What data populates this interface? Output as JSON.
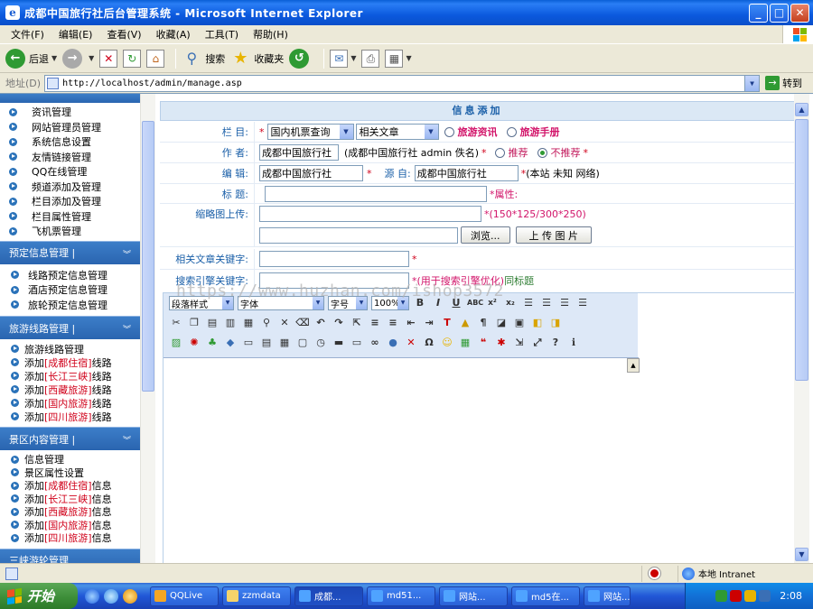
{
  "window": {
    "title": "成都中国旅行社后台管理系统 - Microsoft Internet Explorer",
    "min": "_",
    "max": "□",
    "close": "✕"
  },
  "menu": [
    "文件(F)",
    "编辑(E)",
    "查看(V)",
    "收藏(A)",
    "工具(T)",
    "帮助(H)"
  ],
  "toolbar": {
    "back": "后退",
    "search": "搜索",
    "favorites": "收藏夹"
  },
  "address": {
    "label": "地址(D)",
    "url": "http://localhost/admin/manage.asp",
    "go": "转到"
  },
  "sidebar": {
    "group1_items": [
      "资讯管理",
      "网站管理员管理",
      "系统信息设置",
      "友情链接管理",
      "QQ在线管理",
      "频道添加及管理",
      "栏目添加及管理",
      "栏目属性管理",
      "飞机票管理"
    ],
    "group2": {
      "title": "预定信息管理 |",
      "items": [
        "线路预定信息管理",
        "酒店预定信息管理",
        "旅轮预定信息管理"
      ]
    },
    "group3": {
      "title": "旅游线路管理 |",
      "first": "旅游线路管理",
      "items": [
        {
          "pre": "添加",
          "red": "[成都住宿]",
          "post": "线路"
        },
        {
          "pre": "添加",
          "red": "[长江三峡]",
          "post": "线路"
        },
        {
          "pre": "添加",
          "red": "[西藏旅游]",
          "post": "线路"
        },
        {
          "pre": "添加",
          "red": "[国内旅游]",
          "post": "线路"
        },
        {
          "pre": "添加",
          "red": "[四川旅游]",
          "post": "线路"
        }
      ]
    },
    "group4": {
      "title": "景区内容管理 |",
      "plain": [
        "信息管理",
        "景区属性设置"
      ],
      "items": [
        {
          "pre": "添加",
          "red": "[成都住宿]",
          "post": "信息"
        },
        {
          "pre": "添加",
          "red": "[长江三峡]",
          "post": "信息"
        },
        {
          "pre": "添加",
          "red": "[西藏旅游]",
          "post": "信息"
        },
        {
          "pre": "添加",
          "red": "[国内旅游]",
          "post": "信息"
        },
        {
          "pre": "添加",
          "red": "[四川旅游]",
          "post": "信息"
        }
      ]
    },
    "group5_title": "三峡游轮管理"
  },
  "form": {
    "header": "信息添加",
    "lanmu": {
      "label": "栏 目:",
      "sel1": "国内机票查询",
      "sel2": "相关文章",
      "radio1": "旅游资讯",
      "radio2": "旅游手册"
    },
    "author": {
      "label": "作 者:",
      "value": "成都中国旅行社",
      "hint": "(成都中国旅行社 admin 佚名)",
      "radio1": "推荐",
      "radio2": "不推荐"
    },
    "editor_row": {
      "label": "编 辑:",
      "value": "成都中国旅行社",
      "source_label": "源 自:",
      "source_value": "成都中国旅行社",
      "source_hint": "(本站 未知 网络)"
    },
    "title_row": {
      "label": "标 题:",
      "attr": "*属性:"
    },
    "thumb": {
      "label": "缩略图上传:",
      "hint": "*(150*125/300*250)",
      "browse": "浏览...",
      "upload": "上 传 图 片"
    },
    "keywords": {
      "label": "相关文章关键字:"
    },
    "seo": {
      "label": "搜索引擎关键字:",
      "hint": "*(用于搜索引擎优化)",
      "hint2": "同标题"
    }
  },
  "editor": {
    "style": "段落样式",
    "font": "字体",
    "size": "字号",
    "zoom": "100%"
  },
  "watermark": "https://www.huzhan.com/ishop3572",
  "status": {
    "zone": "本地 Intranet"
  },
  "taskbar": {
    "start": "开始",
    "tasks": [
      "QQLive",
      "zzmdata",
      "成都...",
      "md51...",
      "网站...",
      "md5在...",
      "网站..."
    ],
    "time": "2:08"
  }
}
